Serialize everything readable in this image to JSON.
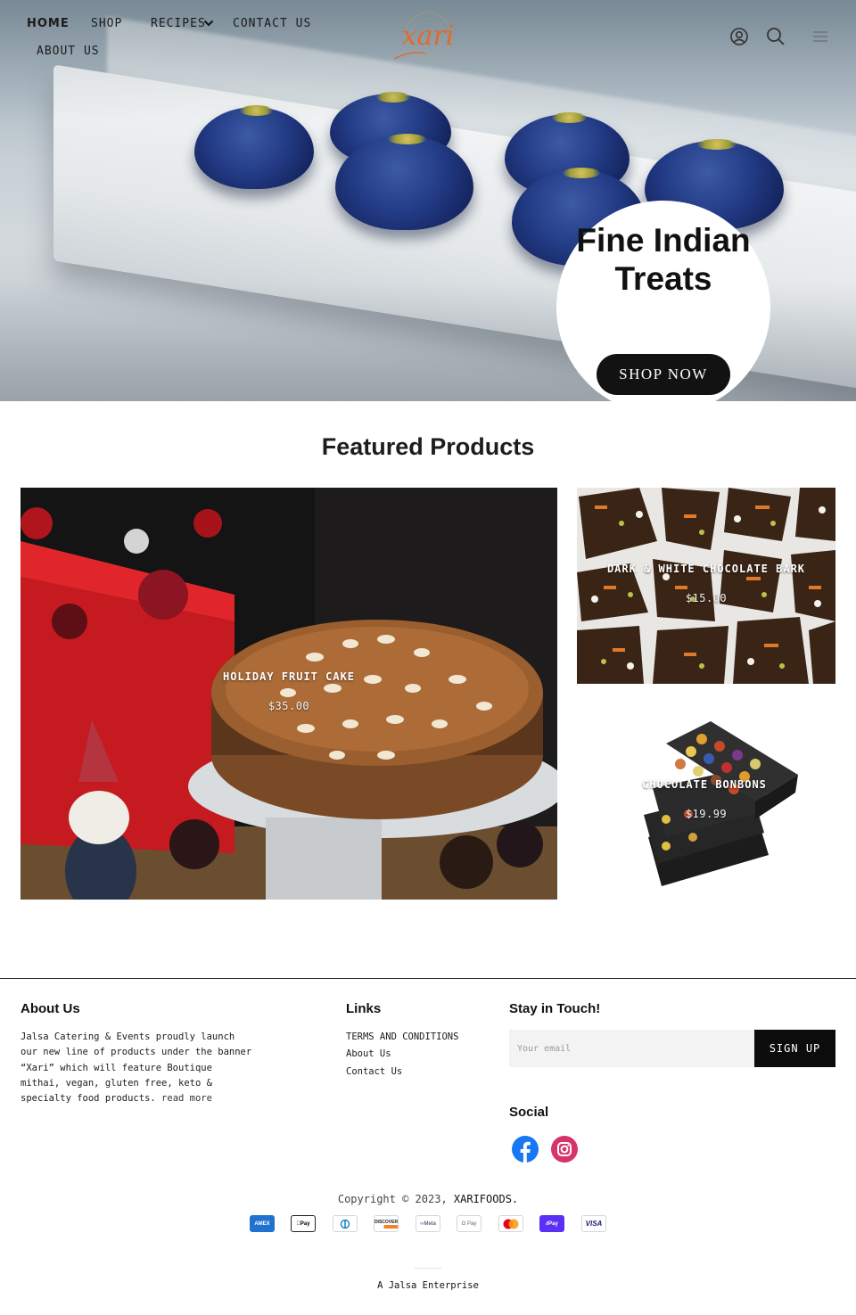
{
  "nav": {
    "items": [
      {
        "label": "HOME",
        "active": true
      },
      {
        "label": "SHOP"
      },
      {
        "label": "RECIPES"
      },
      {
        "label": "CONTACT US"
      },
      {
        "label": "ABOUT US"
      }
    ],
    "logo_text": "xari",
    "icons": [
      "account-icon",
      "search-icon",
      "menu-icon"
    ]
  },
  "hero": {
    "title": "Fine Indian Treats",
    "cta_label": "SHOP NOW"
  },
  "featured": {
    "heading": "Featured Products",
    "products": [
      {
        "name": "HOLIDAY FRUIT CAKE",
        "price": "$35.00"
      },
      {
        "name": "DARK & WHITE CHOCOLATE BARK",
        "price": "$15.00"
      },
      {
        "name": "CHOCOLATE BONBONS",
        "price": "$19.99"
      }
    ]
  },
  "footer": {
    "about": {
      "heading": "About Us",
      "text": "Jalsa Catering & Events proudly launch our new line of products under the banner “Xari” which will feature Boutique mithai, vegan, gluten free, keto & specialty food products.",
      "read_more": "read more"
    },
    "links": {
      "heading": "Links",
      "items": [
        "TERMS AND CONDITIONS",
        "About Us",
        "Contact Us"
      ]
    },
    "newsletter": {
      "heading": "Stay in Touch!",
      "placeholder": "Your email",
      "button_label": "SIGN UP"
    },
    "social": {
      "heading": "Social",
      "icons": [
        "facebook-icon",
        "instagram-icon"
      ]
    },
    "copyright_prefix": "Copyright © 2023,",
    "copyright_brand": "XARIFOODS.",
    "payment_methods": [
      "AMEX",
      "Pay",
      "Diners",
      "DISCOVER",
      "Meta",
      "G Pay",
      "Mastercard",
      "Pay",
      "VISA"
    ],
    "enterprise": "A Jalsa Enterprise"
  },
  "colors": {
    "accent_logo": "#e06a2a",
    "button_dark": "#121212",
    "facebook": "#1877f2",
    "instagram": "#d6336c"
  }
}
